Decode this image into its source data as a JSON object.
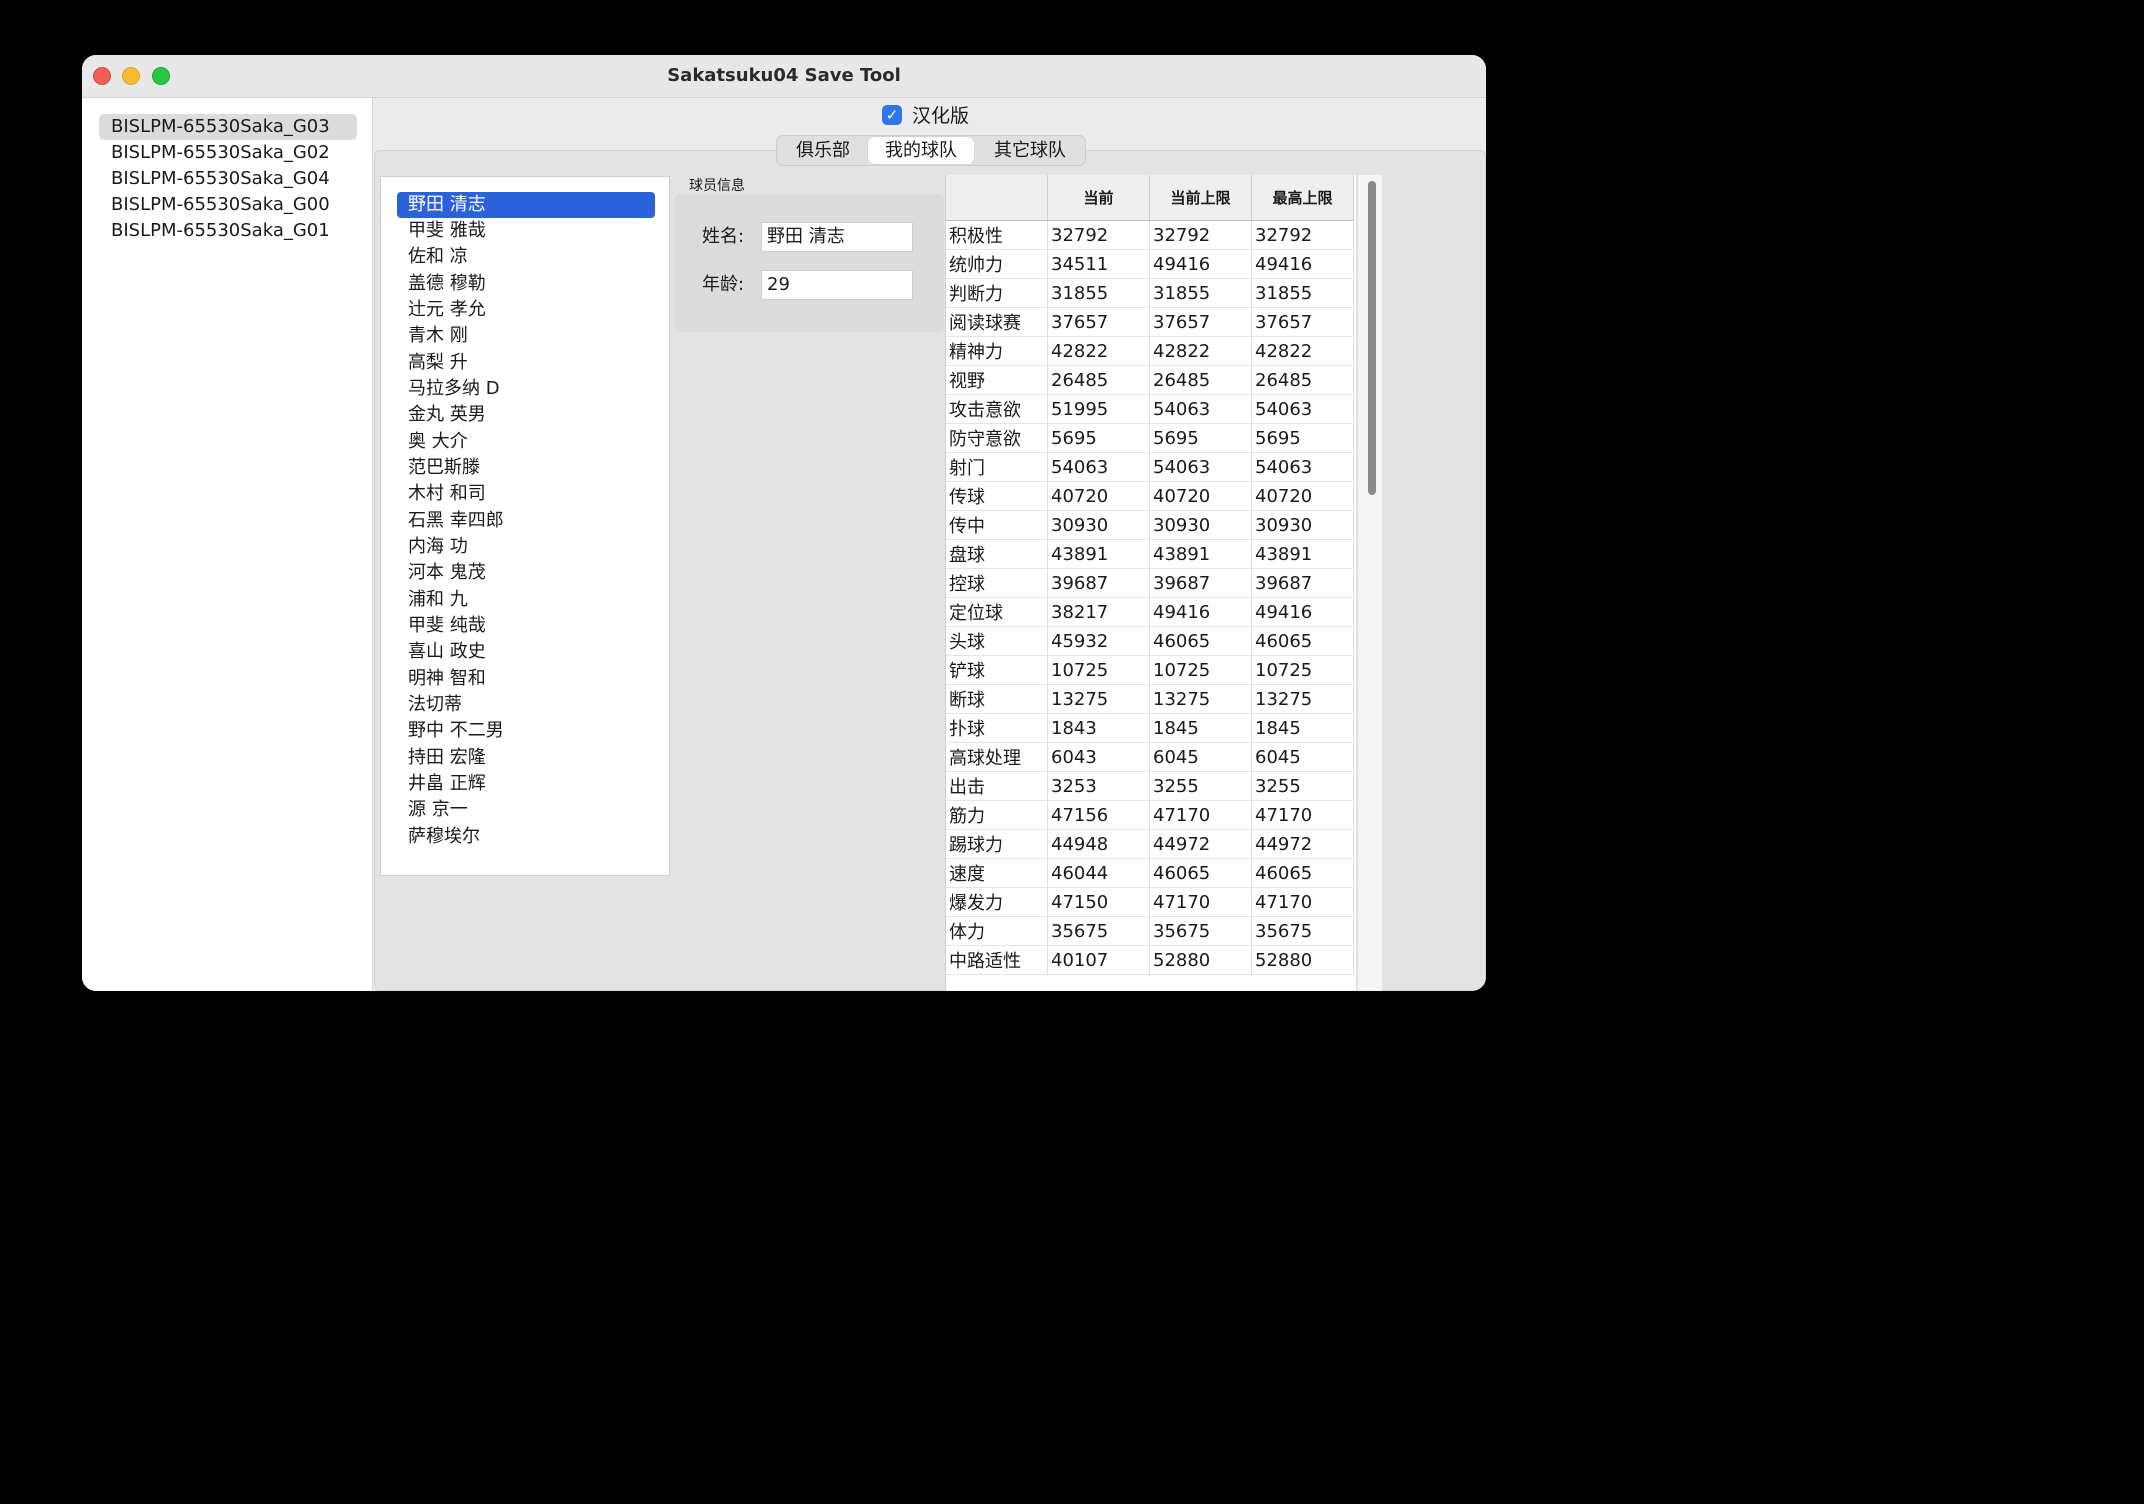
{
  "window": {
    "title": "Sakatsuku04 Save Tool"
  },
  "files": [
    {
      "label": "BISLPM-65530Saka_G03",
      "selected": true
    },
    {
      "label": "BISLPM-65530Saka_G02",
      "selected": false
    },
    {
      "label": "BISLPM-65530Saka_G04",
      "selected": false
    },
    {
      "label": "BISLPM-65530Saka_G00",
      "selected": false
    },
    {
      "label": "BISLPM-65530Saka_G01",
      "selected": false
    }
  ],
  "localized": {
    "label": "汉化版",
    "checked": true
  },
  "tabs": [
    {
      "label": "俱乐部",
      "active": false
    },
    {
      "label": "我的球队",
      "active": true
    },
    {
      "label": "其它球队",
      "active": false
    }
  ],
  "players": [
    "野田 清志",
    "甲斐 雅哉",
    "佐和 凉",
    "盖德 穆勒",
    "辻元 孝允",
    "青木 刚",
    "高梨 升",
    "马拉多纳 D",
    "金丸 英男",
    "奥 大介",
    "范巴斯滕",
    "木村 和司",
    "石黑 幸四郎",
    "内海 功",
    "河本 鬼茂",
    "浦和 九",
    "甲斐 纯哉",
    "喜山 政史",
    "明神 智和",
    "法切蒂",
    "野中 不二男",
    "持田 宏隆",
    "井畠 正辉",
    "源 京一",
    "萨穆埃尔"
  ],
  "selected_player_index": 0,
  "player_info": {
    "section_label": "球员信息",
    "name_label": "姓名:",
    "name_value": "野田 清志",
    "age_label": "年龄:",
    "age_value": "29"
  },
  "stats": {
    "headers": [
      "",
      "当前",
      "当前上限",
      "最高上限"
    ],
    "rows": [
      [
        "积极性",
        "32792",
        "32792",
        "32792"
      ],
      [
        "统帅力",
        "34511",
        "49416",
        "49416"
      ],
      [
        "判断力",
        "31855",
        "31855",
        "31855"
      ],
      [
        "阅读球赛",
        "37657",
        "37657",
        "37657"
      ],
      [
        "精神力",
        "42822",
        "42822",
        "42822"
      ],
      [
        "视野",
        "26485",
        "26485",
        "26485"
      ],
      [
        "攻击意欲",
        "51995",
        "54063",
        "54063"
      ],
      [
        "防守意欲",
        "5695",
        "5695",
        "5695"
      ],
      [
        "射门",
        "54063",
        "54063",
        "54063"
      ],
      [
        "传球",
        "40720",
        "40720",
        "40720"
      ],
      [
        "传中",
        "30930",
        "30930",
        "30930"
      ],
      [
        "盘球",
        "43891",
        "43891",
        "43891"
      ],
      [
        "控球",
        "39687",
        "39687",
        "39687"
      ],
      [
        "定位球",
        "38217",
        "49416",
        "49416"
      ],
      [
        "头球",
        "45932",
        "46065",
        "46065"
      ],
      [
        "铲球",
        "10725",
        "10725",
        "10725"
      ],
      [
        "断球",
        "13275",
        "13275",
        "13275"
      ],
      [
        "扑球",
        "1843",
        "1845",
        "1845"
      ],
      [
        "高球处理",
        "6043",
        "6045",
        "6045"
      ],
      [
        "出击",
        "3253",
        "3255",
        "3255"
      ],
      [
        "筋力",
        "47156",
        "47170",
        "47170"
      ],
      [
        "踢球力",
        "44948",
        "44972",
        "44972"
      ],
      [
        "速度",
        "46044",
        "46065",
        "46065"
      ],
      [
        "爆发力",
        "47150",
        "47170",
        "47170"
      ],
      [
        "体力",
        "35675",
        "35675",
        "35675"
      ],
      [
        "中路适性",
        "40107",
        "52880",
        "52880"
      ]
    ]
  },
  "colors": {
    "selection": "#2b62d9",
    "checkbox": "#2f76ea"
  }
}
